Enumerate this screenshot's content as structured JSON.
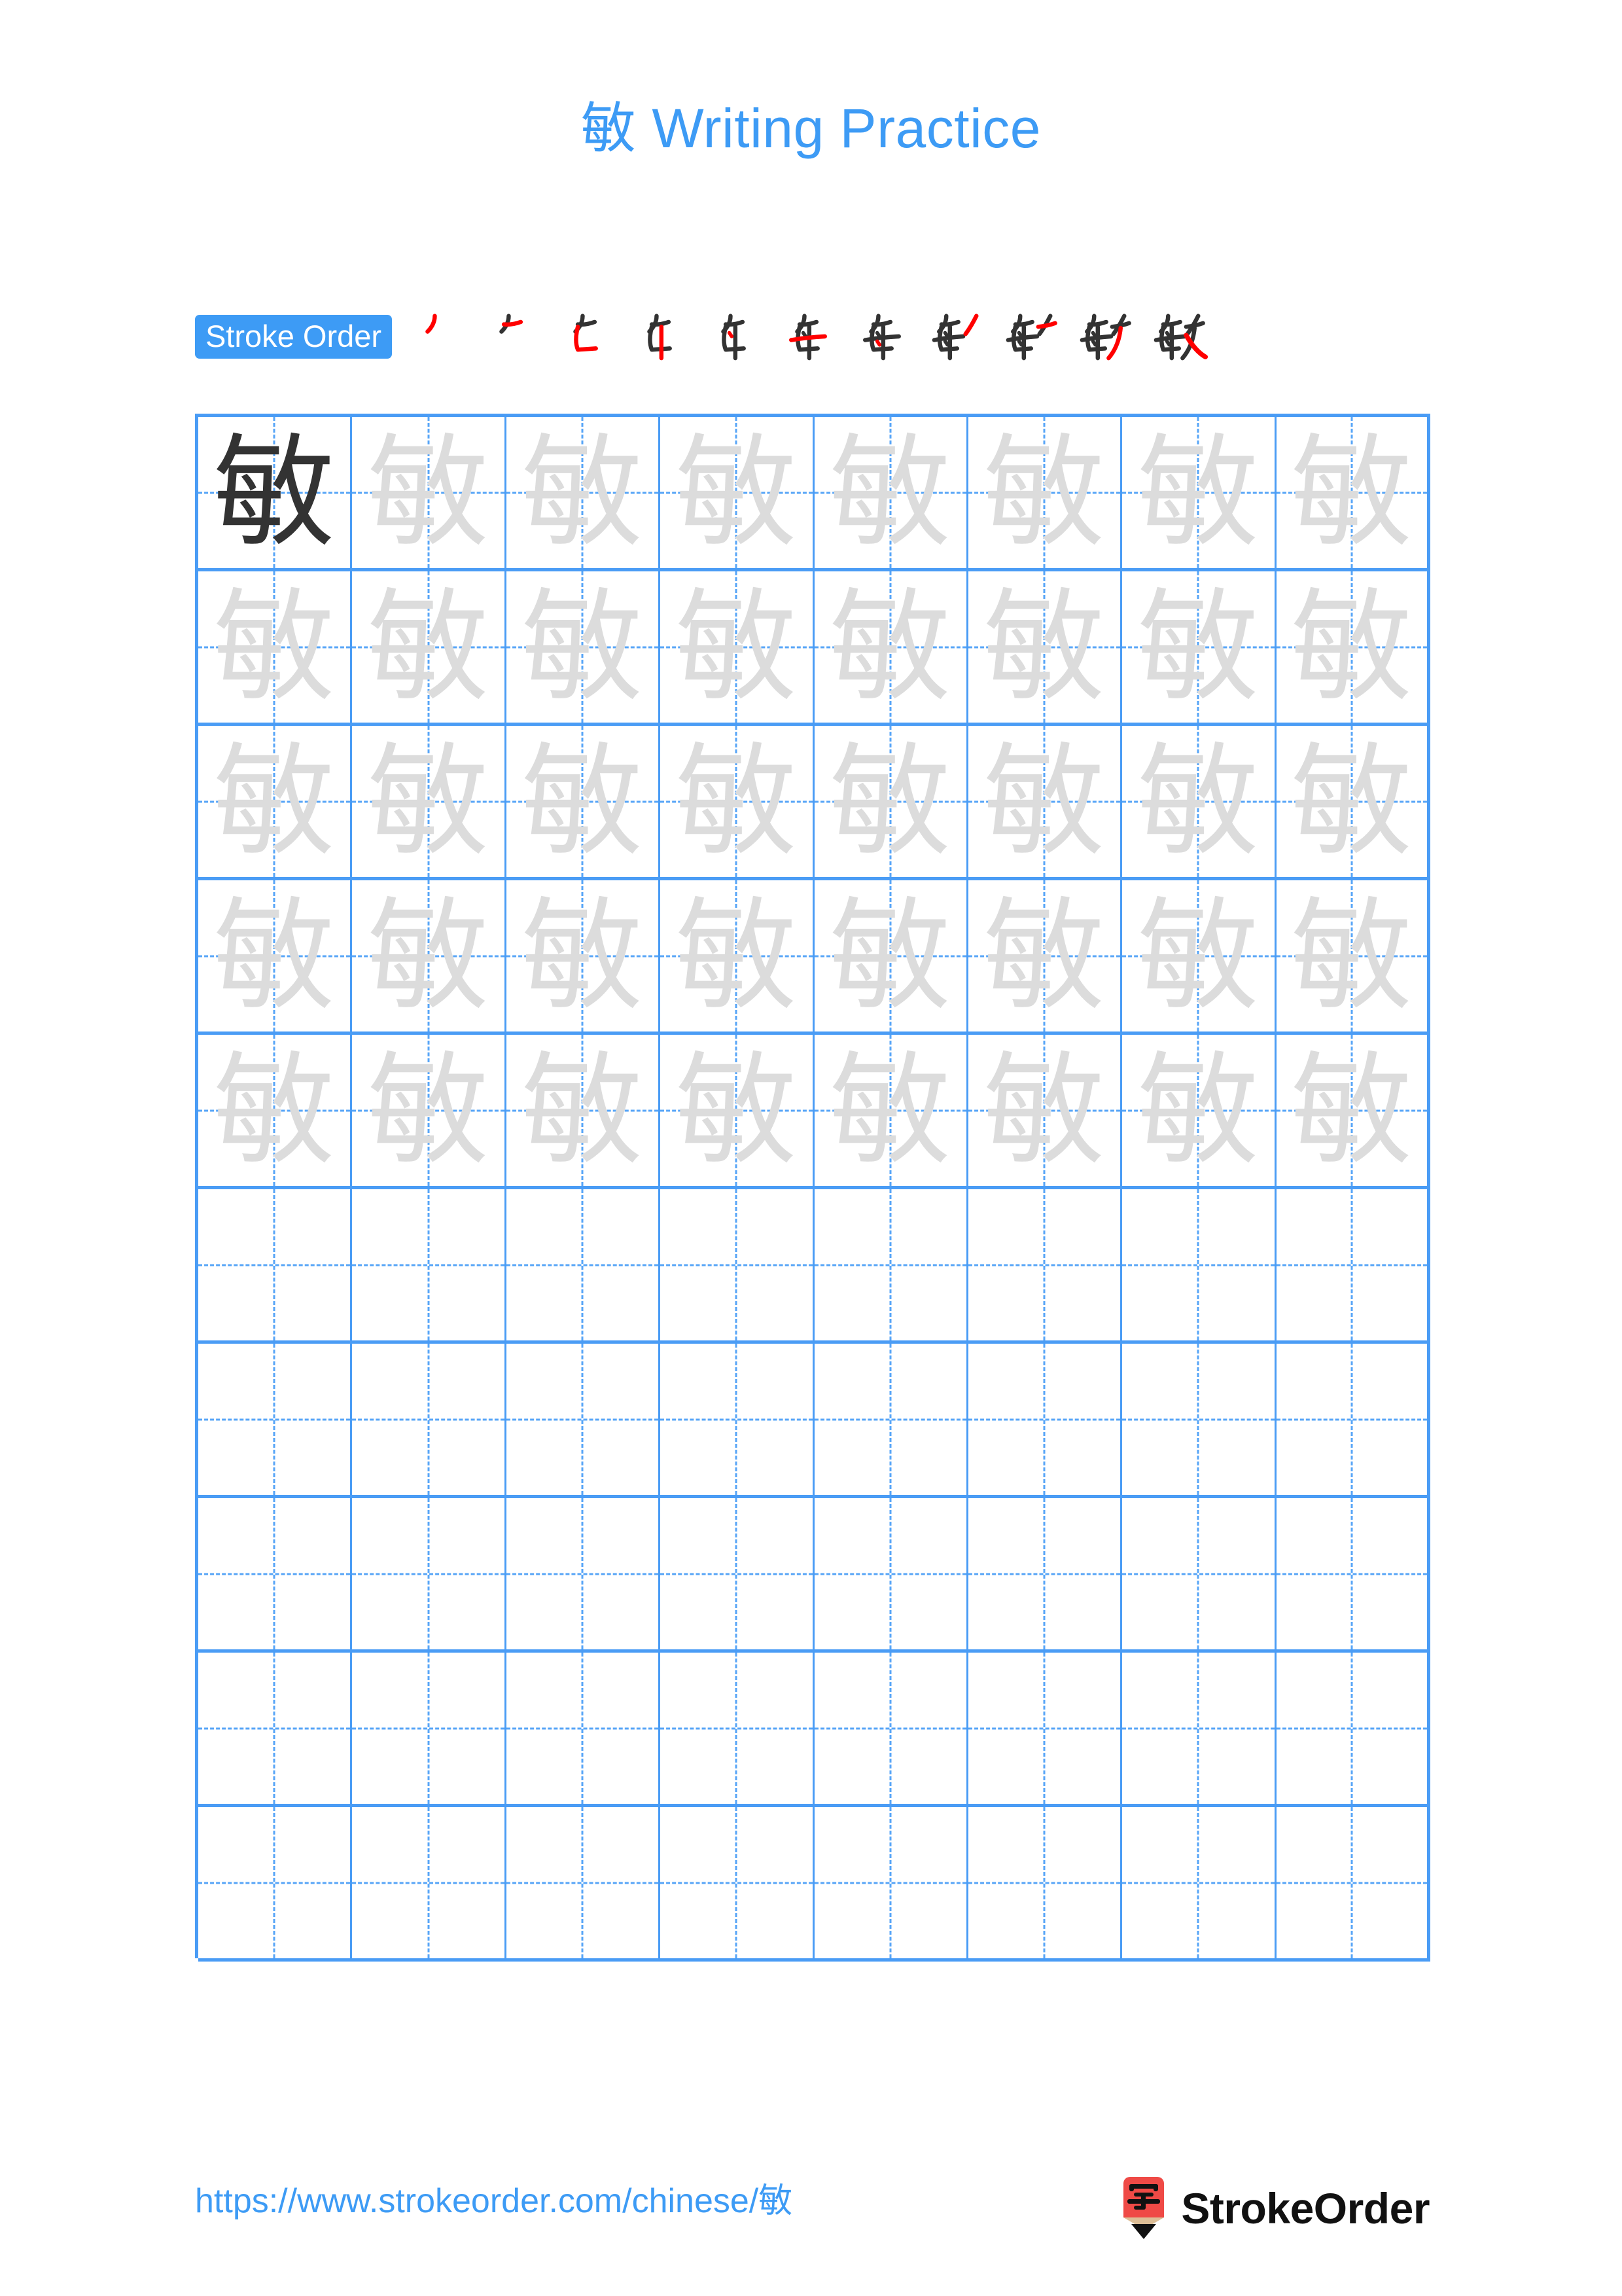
{
  "page": {
    "title_character": "敏",
    "title_suffix": " Writing Practice",
    "title_full": "敏 Writing Practice",
    "background_color": "#ffffff",
    "accent_color": "#3d9bf5",
    "grid_line_color": "#4a9cf5",
    "model_char_color": "#333333",
    "trace_char_color": "#dcdcdc",
    "stroke_new_color": "#ff0000",
    "stroke_done_color": "#333333"
  },
  "stroke_order": {
    "badge_label": "Stroke Order",
    "character": "敏",
    "total_strokes": 11,
    "steps": [
      {
        "index": 1,
        "cumulative_strokes": 1,
        "new_stroke_color": "#ff0000"
      },
      {
        "index": 2,
        "cumulative_strokes": 2,
        "new_stroke_color": "#ff0000"
      },
      {
        "index": 3,
        "cumulative_strokes": 3,
        "new_stroke_color": "#ff0000"
      },
      {
        "index": 4,
        "cumulative_strokes": 4,
        "new_stroke_color": "#ff0000"
      },
      {
        "index": 5,
        "cumulative_strokes": 5,
        "new_stroke_color": "#ff0000"
      },
      {
        "index": 6,
        "cumulative_strokes": 6,
        "new_stroke_color": "#ff0000"
      },
      {
        "index": 7,
        "cumulative_strokes": 7,
        "new_stroke_color": "#ff0000"
      },
      {
        "index": 8,
        "cumulative_strokes": 8,
        "new_stroke_color": "#ff0000"
      },
      {
        "index": 9,
        "cumulative_strokes": 9,
        "new_stroke_color": "#ff0000"
      },
      {
        "index": 10,
        "cumulative_strokes": 10,
        "new_stroke_color": "#ff0000"
      },
      {
        "index": 11,
        "cumulative_strokes": 11,
        "new_stroke_color": "#ff0000"
      }
    ]
  },
  "grid": {
    "columns": 8,
    "rows": 10,
    "filled_rows": 5,
    "empty_rows": 5,
    "model_cell": {
      "row": 1,
      "column": 1,
      "character": "敏"
    },
    "trace_character": "敏",
    "cells": [
      [
        "model",
        "trace",
        "trace",
        "trace",
        "trace",
        "trace",
        "trace",
        "trace"
      ],
      [
        "trace",
        "trace",
        "trace",
        "trace",
        "trace",
        "trace",
        "trace",
        "trace"
      ],
      [
        "trace",
        "trace",
        "trace",
        "trace",
        "trace",
        "trace",
        "trace",
        "trace"
      ],
      [
        "trace",
        "trace",
        "trace",
        "trace",
        "trace",
        "trace",
        "trace",
        "trace"
      ],
      [
        "trace",
        "trace",
        "trace",
        "trace",
        "trace",
        "trace",
        "trace",
        "trace"
      ],
      [
        "blank",
        "blank",
        "blank",
        "blank",
        "blank",
        "blank",
        "blank",
        "blank"
      ],
      [
        "blank",
        "blank",
        "blank",
        "blank",
        "blank",
        "blank",
        "blank",
        "blank"
      ],
      [
        "blank",
        "blank",
        "blank",
        "blank",
        "blank",
        "blank",
        "blank",
        "blank"
      ],
      [
        "blank",
        "blank",
        "blank",
        "blank",
        "blank",
        "blank",
        "blank",
        "blank"
      ],
      [
        "blank",
        "blank",
        "blank",
        "blank",
        "blank",
        "blank",
        "blank",
        "blank"
      ]
    ]
  },
  "footer": {
    "url": "https://www.strokeorder.com/chinese/敏",
    "url_prefix": "https://www.strokeorder.com/chinese/",
    "url_character": "敏",
    "brand_name": "StrokeOrder",
    "logo": {
      "icon_name": "pencil-zi-logo",
      "body_color": "#ef4a46",
      "wood_color": "#ddbe96",
      "tip_color": "#111111",
      "glyph": "字",
      "glyph_color": "#111111"
    }
  }
}
